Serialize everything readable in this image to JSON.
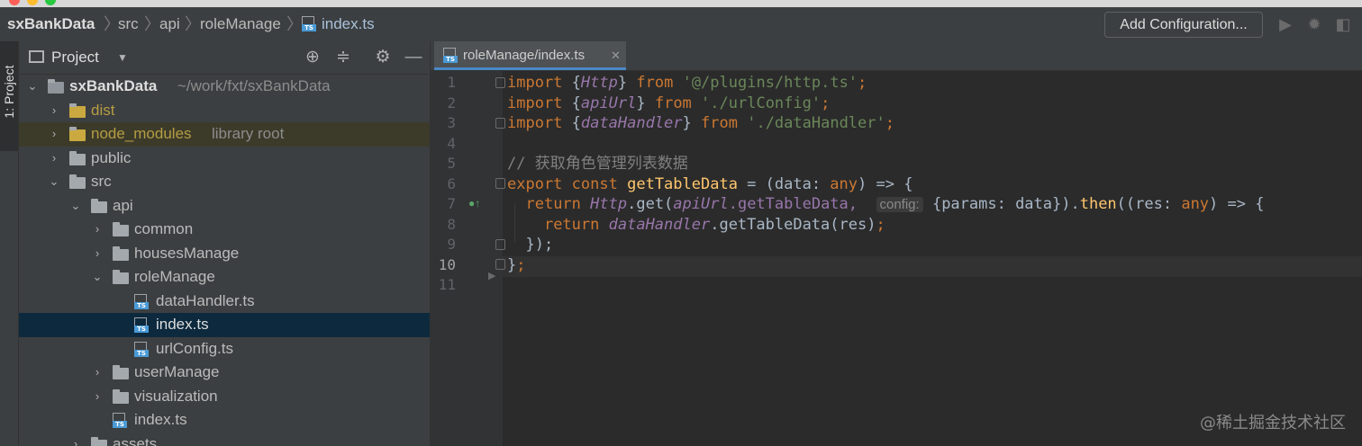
{
  "breadcrumb": {
    "project": "sxBankData",
    "items": [
      "src",
      "api",
      "roleManage"
    ],
    "file": "index.ts"
  },
  "toolbar": {
    "add_configuration": "Add Configuration..."
  },
  "left_strip": {
    "tab_label": "1: Project"
  },
  "project_panel": {
    "title": "Project",
    "tree": [
      {
        "label": "sxBankData",
        "suffix": "~/work/fxt/sxBankData"
      },
      {
        "label": "dist"
      },
      {
        "label": "node_modules",
        "suffix": "library root"
      },
      {
        "label": "public"
      },
      {
        "label": "src"
      },
      {
        "label": "api"
      },
      {
        "label": "common"
      },
      {
        "label": "housesManage"
      },
      {
        "label": "roleManage"
      },
      {
        "label": "dataHandler.ts"
      },
      {
        "label": "index.ts"
      },
      {
        "label": "urlConfig.ts"
      },
      {
        "label": "userManage"
      },
      {
        "label": "visualization"
      },
      {
        "label": "index.ts"
      },
      {
        "label": "assets"
      }
    ],
    "selected": "index.ts"
  },
  "editor": {
    "tab_title": "roleManage/index.ts",
    "line_numbers": [
      "1",
      "2",
      "3",
      "4",
      "5",
      "6",
      "7",
      "8",
      "9",
      "10",
      "11"
    ],
    "current_line": "10",
    "lines": {
      "l1": {
        "kw": "import",
        "b1": "{",
        "name": "Http",
        "b2": "}",
        "from": "from",
        "str": "'@/plugins/http.ts'",
        "end": ";"
      },
      "l2": {
        "kw": "import",
        "b1": "{",
        "name": "apiUrl",
        "b2": "}",
        "from": "from",
        "str": "'./urlConfig'",
        "end": ";"
      },
      "l3": {
        "kw": "import",
        "b1": "{",
        "name": "dataHandler",
        "b2": "}",
        "from": "from",
        "str": "'./dataHandler'",
        "end": ";"
      },
      "l5": {
        "comment": "// 获取角色管理列表数据"
      },
      "l6": {
        "export": "export",
        "const": "const",
        "fn": "getTableData",
        "eq": " = (data: ",
        "any": "any",
        "rest": ") => {"
      },
      "l7": {
        "ret": "return",
        "http": "Http",
        "get": ".get(",
        "api": "apiUrl",
        "prop": ".getTableData,",
        "hint": "config:",
        "params": "{params: data}).",
        "then": "then",
        "args": "((res: ",
        "any": "any",
        "arrow": ") => {"
      },
      "l8": {
        "ret": "return",
        "dh": "dataHandler",
        "call": ".getTableData(res)",
        "end": ";"
      },
      "l9": {
        "text": "});"
      },
      "l10": {
        "text": "}",
        "end": ";"
      }
    }
  },
  "watermark": "@稀土掘金技术社区",
  "colors": {
    "keyword": "#cc7832",
    "string": "#6a8759",
    "identifier_italic": "#9876aa",
    "function": "#ffc66d",
    "selection": "#0d293e",
    "tab_underline": "#4a88c7"
  }
}
